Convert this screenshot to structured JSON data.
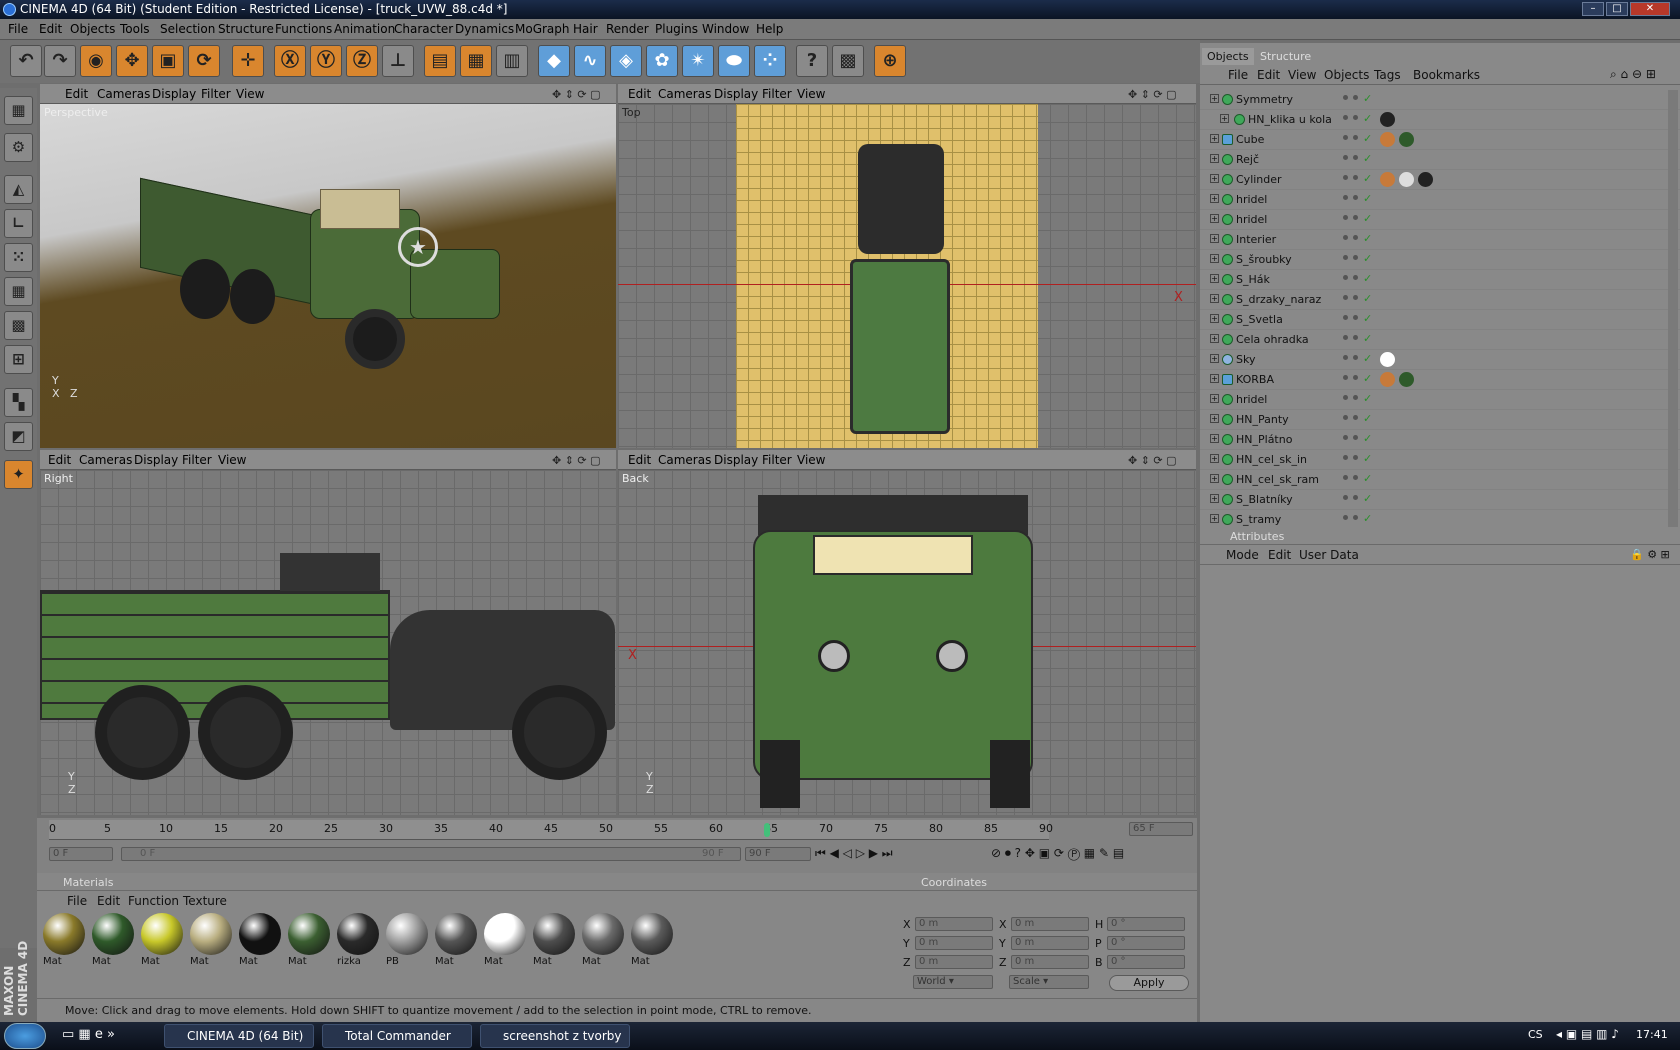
{
  "window": {
    "title": "CINEMA 4D (64 Bit) (Student Edition - Restricted License) - [truck_UVW_88.c4d *]"
  },
  "menu": [
    "File",
    "Edit",
    "Objects",
    "Tools",
    "Selection",
    "Structure",
    "Functions",
    "Animation",
    "Character",
    "Dynamics",
    "MoGraph",
    "Hair",
    "Render",
    "Plugins",
    "Window",
    "Help"
  ],
  "viewport_menu": [
    "Edit",
    "Cameras",
    "Display",
    "Filter",
    "View"
  ],
  "viewports": {
    "perspective": "Perspective",
    "top": "Top",
    "right": "Right",
    "back": "Back"
  },
  "objects_panel": {
    "tabs": [
      "Objects",
      "Structure"
    ],
    "menu": [
      "File",
      "Edit",
      "View",
      "Objects",
      "Tags",
      "Bookmarks"
    ],
    "items": [
      "Symmetry",
      "HN_klika u kola",
      "Cube",
      "Rejč",
      "Cylinder",
      "hridel",
      "hridel",
      "Interier",
      "S_šroubky",
      "S_Hák",
      "S_drzaky_naraz",
      "S_Svetla",
      "Cela ohradka",
      "Sky",
      "KORBA",
      "hridel",
      "HN_Panty",
      "HN_Plátno",
      "HN_cel_sk_in",
      "HN_cel_sk_ram",
      "S_Blatníky",
      "S_tramy"
    ]
  },
  "attributes_panel": {
    "title": "Attributes",
    "menu": [
      "Mode",
      "Edit",
      "User Data"
    ]
  },
  "timeline": {
    "ticks": [
      "0",
      "5",
      "10",
      "15",
      "20",
      "25",
      "30",
      "35",
      "40",
      "45",
      "50",
      "55",
      "60",
      "65",
      "70",
      "75",
      "80",
      "85",
      "90"
    ],
    "current_frame": "65 F",
    "start_field": "0 F",
    "range_start": "0 F",
    "range_end": "90 F",
    "end_field": "90 F",
    "playhead_pct": 72.2
  },
  "materials": {
    "title": "Materials",
    "menu": [
      "File",
      "Edit",
      "Function",
      "Texture"
    ],
    "items": [
      {
        "label": "Mat",
        "color": "#8a7a2a"
      },
      {
        "label": "Mat",
        "color": "#2f5a2a"
      },
      {
        "label": "Mat",
        "color": "#c8c82a"
      },
      {
        "label": "Mat",
        "color": "#b9ae80"
      },
      {
        "label": "Mat",
        "color": "#111111"
      },
      {
        "label": "Mat",
        "color": "#3b5f31"
      },
      {
        "label": "rizka",
        "color": "#2a2a2a"
      },
      {
        "label": "PB",
        "color": "#a0a0a0"
      },
      {
        "label": "Mat",
        "color": "#555555"
      },
      {
        "label": "Mat",
        "color": "#ffffff"
      },
      {
        "label": "Mat",
        "color": "#4e4e4e"
      },
      {
        "label": "Mat",
        "color": "#6a6a6a"
      },
      {
        "label": "Mat",
        "color": "#5b5b5b"
      }
    ]
  },
  "coordinates": {
    "title": "Coordinates",
    "rows": [
      [
        "X",
        "0 m",
        "X",
        "0 m",
        "H",
        "0 °"
      ],
      [
        "Y",
        "0 m",
        "Y",
        "0 m",
        "P",
        "0 °"
      ],
      [
        "Z",
        "0 m",
        "Z",
        "0 m",
        "B",
        "0 °"
      ]
    ],
    "world": "World",
    "scale": "Scale",
    "apply": "Apply"
  },
  "status": "Move: Click and drag to move elements. Hold down SHIFT to quantize movement / add to the selection in point mode, CTRL to remove.",
  "taskbar": {
    "tasks": [
      "CINEMA 4D (64 Bit) ...",
      "Total Commander 7....",
      "screenshot z tvorby ..."
    ],
    "lang": "CS",
    "clock": "17:41"
  }
}
